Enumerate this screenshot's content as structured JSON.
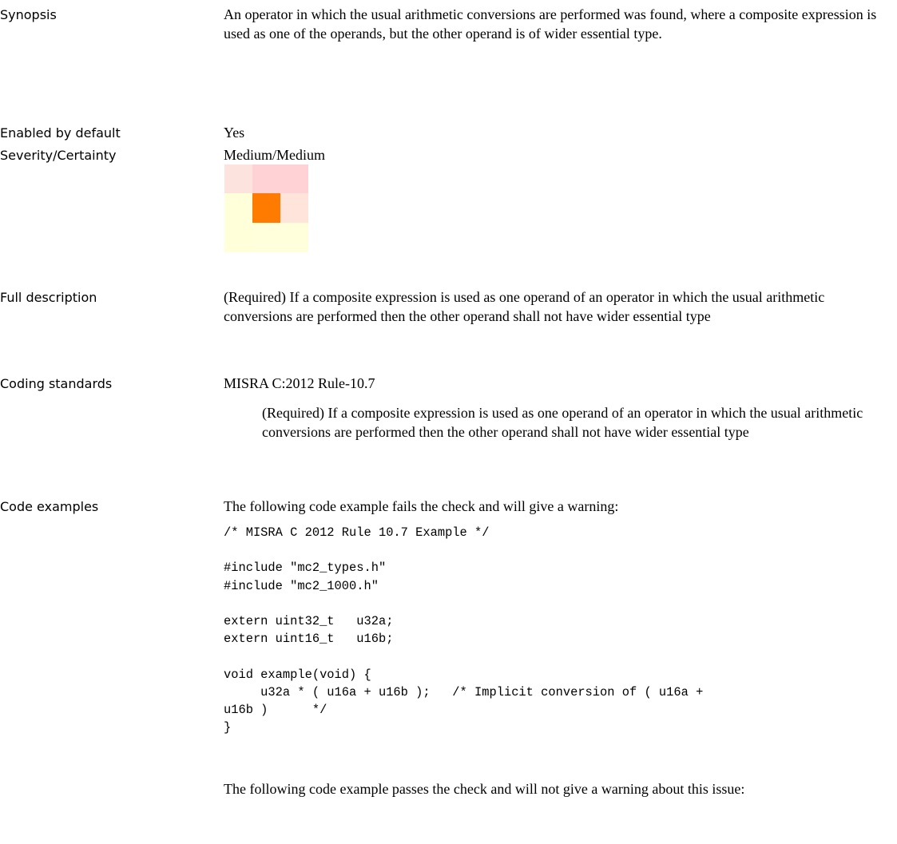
{
  "rows": {
    "synopsis": {
      "label": "Synopsis",
      "text": "An operator in which the usual arithmetic conversions are performed was found, where a composite expression is used as one of the operands, but the other operand is of wider essential type."
    },
    "enabled": {
      "label": "Enabled by default",
      "text": "Yes"
    },
    "severity": {
      "label": "Severity/Certainty",
      "text": "Medium/Medium"
    },
    "full_description": {
      "label": "Full description",
      "text": "(Required) If a composite expression is used as one operand of an operator in which the usual arithmetic conversions are performed then the other operand shall not have wider essential type"
    },
    "coding_standards": {
      "label": "Coding standards",
      "standard": "MISRA C:2012 Rule-10.7",
      "standard_description": "(Required) If a composite expression is used as one operand of an operator in which the usual arithmetic conversions are performed then the other operand shall not have wider essential type"
    },
    "code_examples": {
      "label": "Code examples",
      "fail_intro": "The following code example fails the check and will give a warning:",
      "fail_code": "/* MISRA C 2012 Rule 10.7 Example */\n\n#include \"mc2_types.h\"\n#include \"mc2_1000.h\"\n\nextern uint32_t   u32a;\nextern uint16_t   u16b;\n\nvoid example(void) {\n     u32a * ( u16a + u16b );   /* Implicit conversion of ( u16a +\nu16b )      */\n}",
      "pass_intro": "The following code example passes the check and will not give a warning about this issue:"
    }
  },
  "severity_matrix": {
    "colors": [
      [
        "#fde3de",
        "#ffd3d6",
        "#ffd3d6"
      ],
      [
        "#ffffda",
        "#ff7b00",
        "#fee4da"
      ],
      [
        "#ffffda",
        "#ffffdc",
        "#ffffdc"
      ]
    ],
    "highlight": {
      "severity": "Medium",
      "certainty": "Medium"
    }
  }
}
